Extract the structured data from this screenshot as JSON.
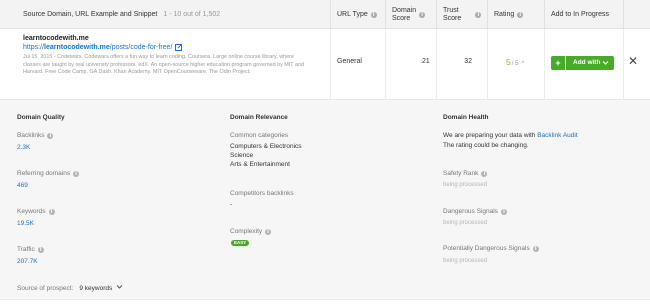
{
  "header": {
    "col_source": "Source Domain, URL Example and Snippet",
    "col_source_count": "1 - 10 out of 1,502",
    "col_url_type": "URL Type",
    "col_domain_score_l1": "Domain",
    "col_domain_score_l2": "Score",
    "col_trust_score_l1": "Trust",
    "col_trust_score_l2": "Score",
    "col_rating": "Rating",
    "col_add": "Add to In Progress"
  },
  "row": {
    "domain": "learntocodewith.me",
    "url_prefix": "https://",
    "url_bold": "learntocodewith.me",
    "url_path": "/posts/code-for-free/",
    "snippet": "Jul 15, 2015 - Codewars. Codewars offers a fun way to learn coding. Coursera. Large online course library, where classes are taught by real university professors. edX. An open-source higher education program governed by MIT and Harvard. Free Code Camp. GA Dash. Khan Academy. MIT OpenCourseware. The Odin Project.",
    "url_type": "General",
    "domain_score": "21",
    "trust_score": "32",
    "rating_value": "5",
    "rating_max": "/ 5",
    "rating_arrow": "^",
    "add_plus": "+",
    "add_label": "Add with"
  },
  "details": {
    "quality": {
      "title": "Domain Quality",
      "backlinks_label": "Backlinks",
      "backlinks_value": "2.3K",
      "referring_label": "Referring domains",
      "referring_value": "469",
      "keywords_label": "Keywords",
      "keywords_value": "19.5K",
      "traffic_label": "Traffic",
      "traffic_value": "207.7K"
    },
    "relevance": {
      "title": "Domain Relevance",
      "categories_label": "Common categories",
      "categories": [
        "Computers & Electronics",
        "Science",
        "Arts & Entertainment"
      ],
      "competitors_label": "Competitors backlinks",
      "competitors_value": "-",
      "complexity_label": "Complexity",
      "complexity_badge": "EASY"
    },
    "health": {
      "title": "Domain Health",
      "preparing_text": "We are preparing your data with ",
      "audit_link": "Backlink Audit",
      "changing_text": "The rating could be changing.",
      "safety_label": "Safety Rank",
      "safety_value": "being processed",
      "dangerous_label": "Dangerous Signals",
      "dangerous_value": "being processed",
      "potential_label": "Potentially Dangerous Signals",
      "potential_value": "being processed"
    },
    "source_label": "Source of prospect:",
    "source_value": "9 keywords"
  },
  "colors": {
    "accent_green": "#4aa82a",
    "link_blue": "#1a73c8",
    "rating_green": "#8ab31e"
  }
}
